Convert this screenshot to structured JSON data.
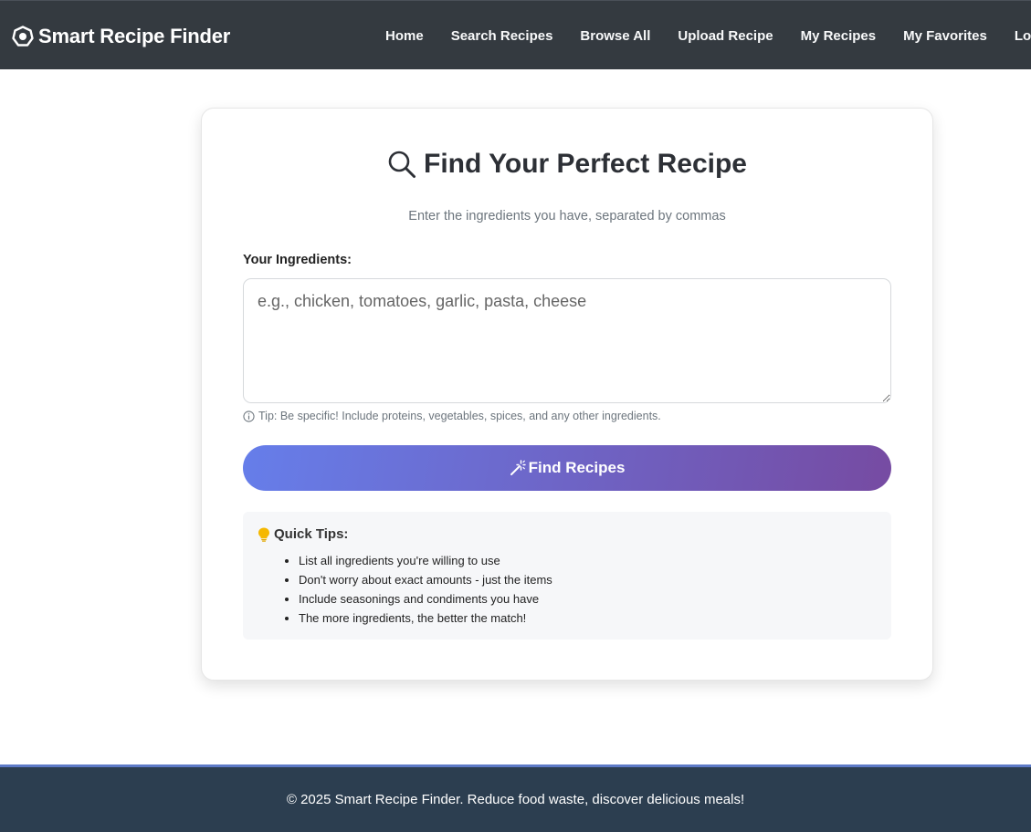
{
  "navbar": {
    "brand": "Smart Recipe Finder",
    "brand_icon": "egg-icon",
    "links": [
      {
        "label": "Home"
      },
      {
        "label": "Search Recipes"
      },
      {
        "label": "Browse All"
      },
      {
        "label": "Upload Recipe"
      },
      {
        "label": "My Recipes"
      },
      {
        "label": "My Favorites"
      },
      {
        "label": "Logout"
      }
    ]
  },
  "search_card": {
    "title": "Find Your Perfect Recipe",
    "title_icon": "search-icon",
    "subtitle": "Enter the ingredients you have, separated by commas",
    "ingredients_label": "Your Ingredients:",
    "ingredients_placeholder": "e.g., chicken, tomatoes, garlic, pasta, cheese",
    "ingredients_value": "",
    "tip_icon": "info-icon",
    "tip": "Tip: Be specific! Include proteins, vegetables, spices, and any other ingredients.",
    "submit_icon": "magic-wand-icon",
    "submit_label": "Find Recipes",
    "quick_tips": {
      "icon": "lightbulb-icon",
      "title": "Quick Tips:",
      "items": [
        "List all ingredients you're willing to use",
        "Don't worry about exact amounts - just the items",
        "Include seasonings and condiments you have",
        "The more ingredients, the better the match!"
      ]
    }
  },
  "footer": {
    "text": "© 2025 Smart Recipe Finder. Reduce food waste, discover delicious meals!"
  },
  "colors": {
    "navbar_bg": "#343a40",
    "footer_bg": "#2c3e50",
    "button_gradient_start": "#667eea",
    "button_gradient_end": "#764ba2",
    "bulb": "#f5b800"
  }
}
